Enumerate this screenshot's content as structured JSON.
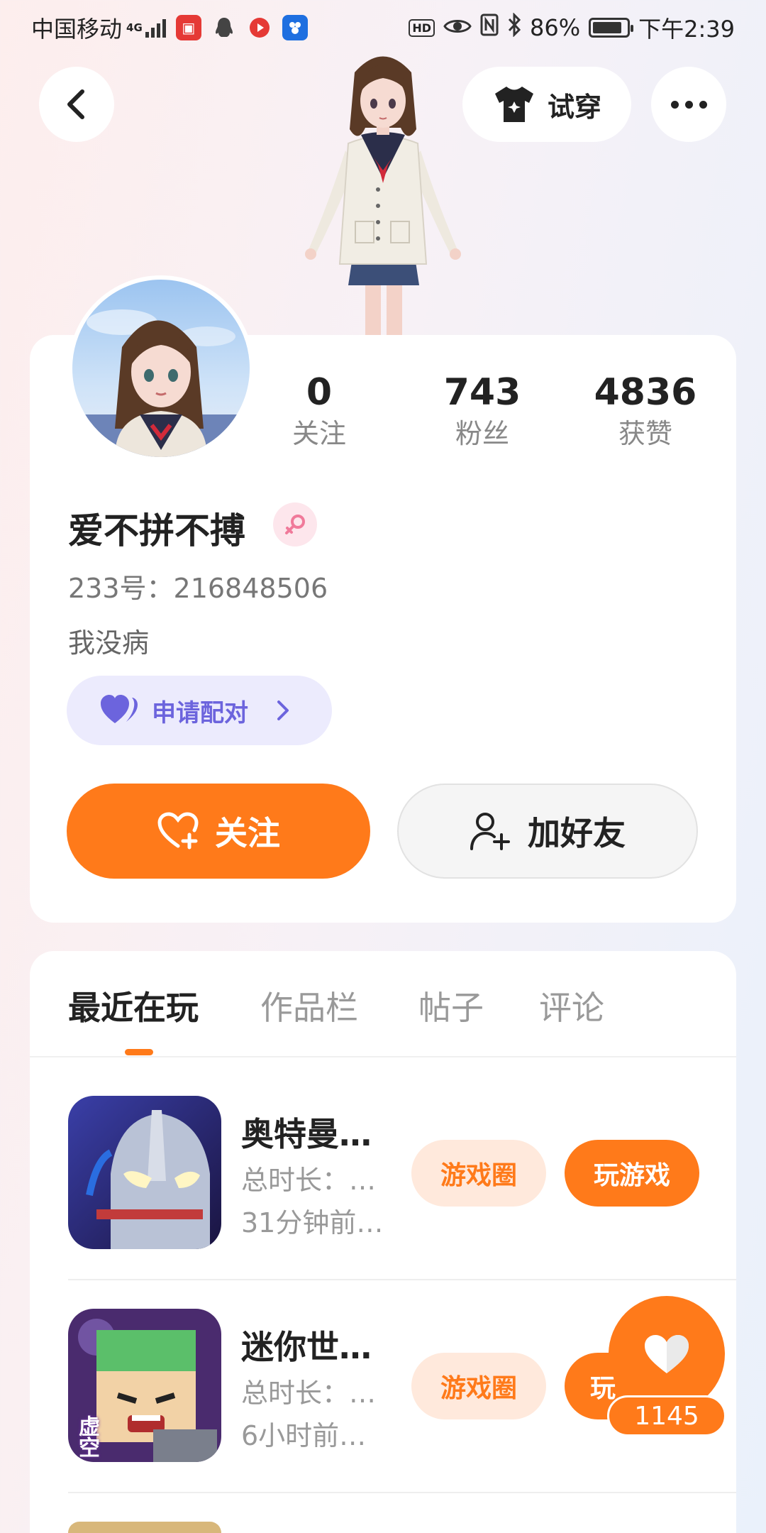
{
  "status_bar": {
    "carrier": "中国移动",
    "network": "4G",
    "battery": "86%",
    "battery_level": 0.86,
    "time": "下午2:39",
    "hd_label": "HD"
  },
  "header": {
    "try_on_label": "试穿"
  },
  "profile": {
    "stats": [
      {
        "value": "0",
        "label": "关注"
      },
      {
        "value": "743",
        "label": "粉丝"
      },
      {
        "value": "4836",
        "label": "获赞"
      }
    ],
    "username": "爱不拼不搏",
    "id_line": "233号：216848506",
    "bio": "我没病",
    "pair_label": "申请配对",
    "follow_label": "关注",
    "add_friend_label": "加好友"
  },
  "tabs": [
    {
      "label": "最近在玩",
      "active": true
    },
    {
      "label": "作品栏",
      "active": false
    },
    {
      "label": "帖子",
      "active": false
    },
    {
      "label": "评论",
      "active": false
    }
  ],
  "games": [
    {
      "title": "奥特曼…",
      "duration": "总时长：…",
      "last_played": "31分钟前…",
      "circle_label": "游戏圈",
      "play_label": "玩游戏"
    },
    {
      "title": "迷你世…",
      "duration": "总时长：…",
      "last_played": "6小时前…",
      "circle_label": "游戏圈",
      "play_label": "玩",
      "icon_text": "虚空"
    }
  ],
  "like_count": "1145",
  "colors": {
    "accent": "#ff7a1a",
    "pair_bg": "#ecebfd",
    "pair_text": "#6c64dd"
  }
}
